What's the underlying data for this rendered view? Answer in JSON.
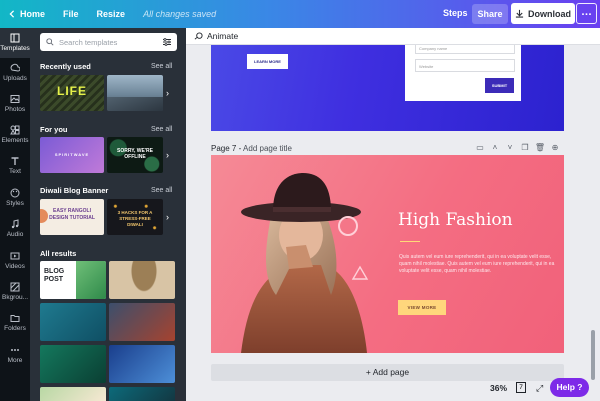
{
  "topbar": {
    "home": "Home",
    "file": "File",
    "resize": "Resize",
    "saved": "All changes saved",
    "steps": "Steps",
    "share": "Share",
    "download": "Download",
    "more": "…",
    "gradient": [
      "#12b7c6",
      "#3a87e6",
      "#6a3ff0"
    ]
  },
  "rail": {
    "items": [
      {
        "label": "Templates",
        "icon": "templates-icon"
      },
      {
        "label": "Uploads",
        "icon": "upload-icon"
      },
      {
        "label": "Photos",
        "icon": "photo-icon"
      },
      {
        "label": "Elements",
        "icon": "elements-icon"
      },
      {
        "label": "Text",
        "icon": "text-icon"
      },
      {
        "label": "Styles",
        "icon": "palette-icon"
      },
      {
        "label": "Audio",
        "icon": "music-icon"
      },
      {
        "label": "Videos",
        "icon": "video-icon"
      },
      {
        "label": "Bkgrou...",
        "icon": "background-icon"
      },
      {
        "label": "Folders",
        "icon": "folder-icon"
      },
      {
        "label": "More",
        "icon": "more-icon"
      }
    ]
  },
  "panel": {
    "search_placeholder": "Search templates",
    "see_all": "See all",
    "sections": {
      "recent": {
        "title": "Recently used",
        "thumbs": [
          "LIFE",
          ""
        ]
      },
      "for_you": {
        "title": "For you",
        "thumbs": [
          "SPIRITWAVE",
          "SORRY, WE'RE OFFLINE"
        ]
      },
      "diwali": {
        "title": "Diwali Blog Banner",
        "thumbs": [
          "EASY RANGOLI DESIGN TUTORIAL",
          "3 HACKS FOR A STRESS-FREE DIWALI"
        ]
      },
      "all": {
        "title": "All results",
        "thumbs": [
          "BLOG POST"
        ]
      }
    }
  },
  "canvas": {
    "toolbar_label": "Animate",
    "page6": {
      "learn_more": "LEARN MORE",
      "field_top": "Company name",
      "field_website": "Website",
      "submit": "SUBMIT"
    },
    "page7_prefix": "Page 7 -",
    "page7_title_placeholder": "Add page title",
    "page7": {
      "headline": "High Fashion",
      "body": "Quis autem vel eum iure reprehenderit, qui in ea voluptate velit esse, quam nihil molestiae. Quis autem vel eum iure reprehenderit, qui in ea voluptate velit esse, quam nihil molestiae.",
      "cta": "VIEW MORE"
    },
    "add_page": "+ Add page",
    "zoom": "36%",
    "page_count": "7",
    "help": "Help ?"
  }
}
